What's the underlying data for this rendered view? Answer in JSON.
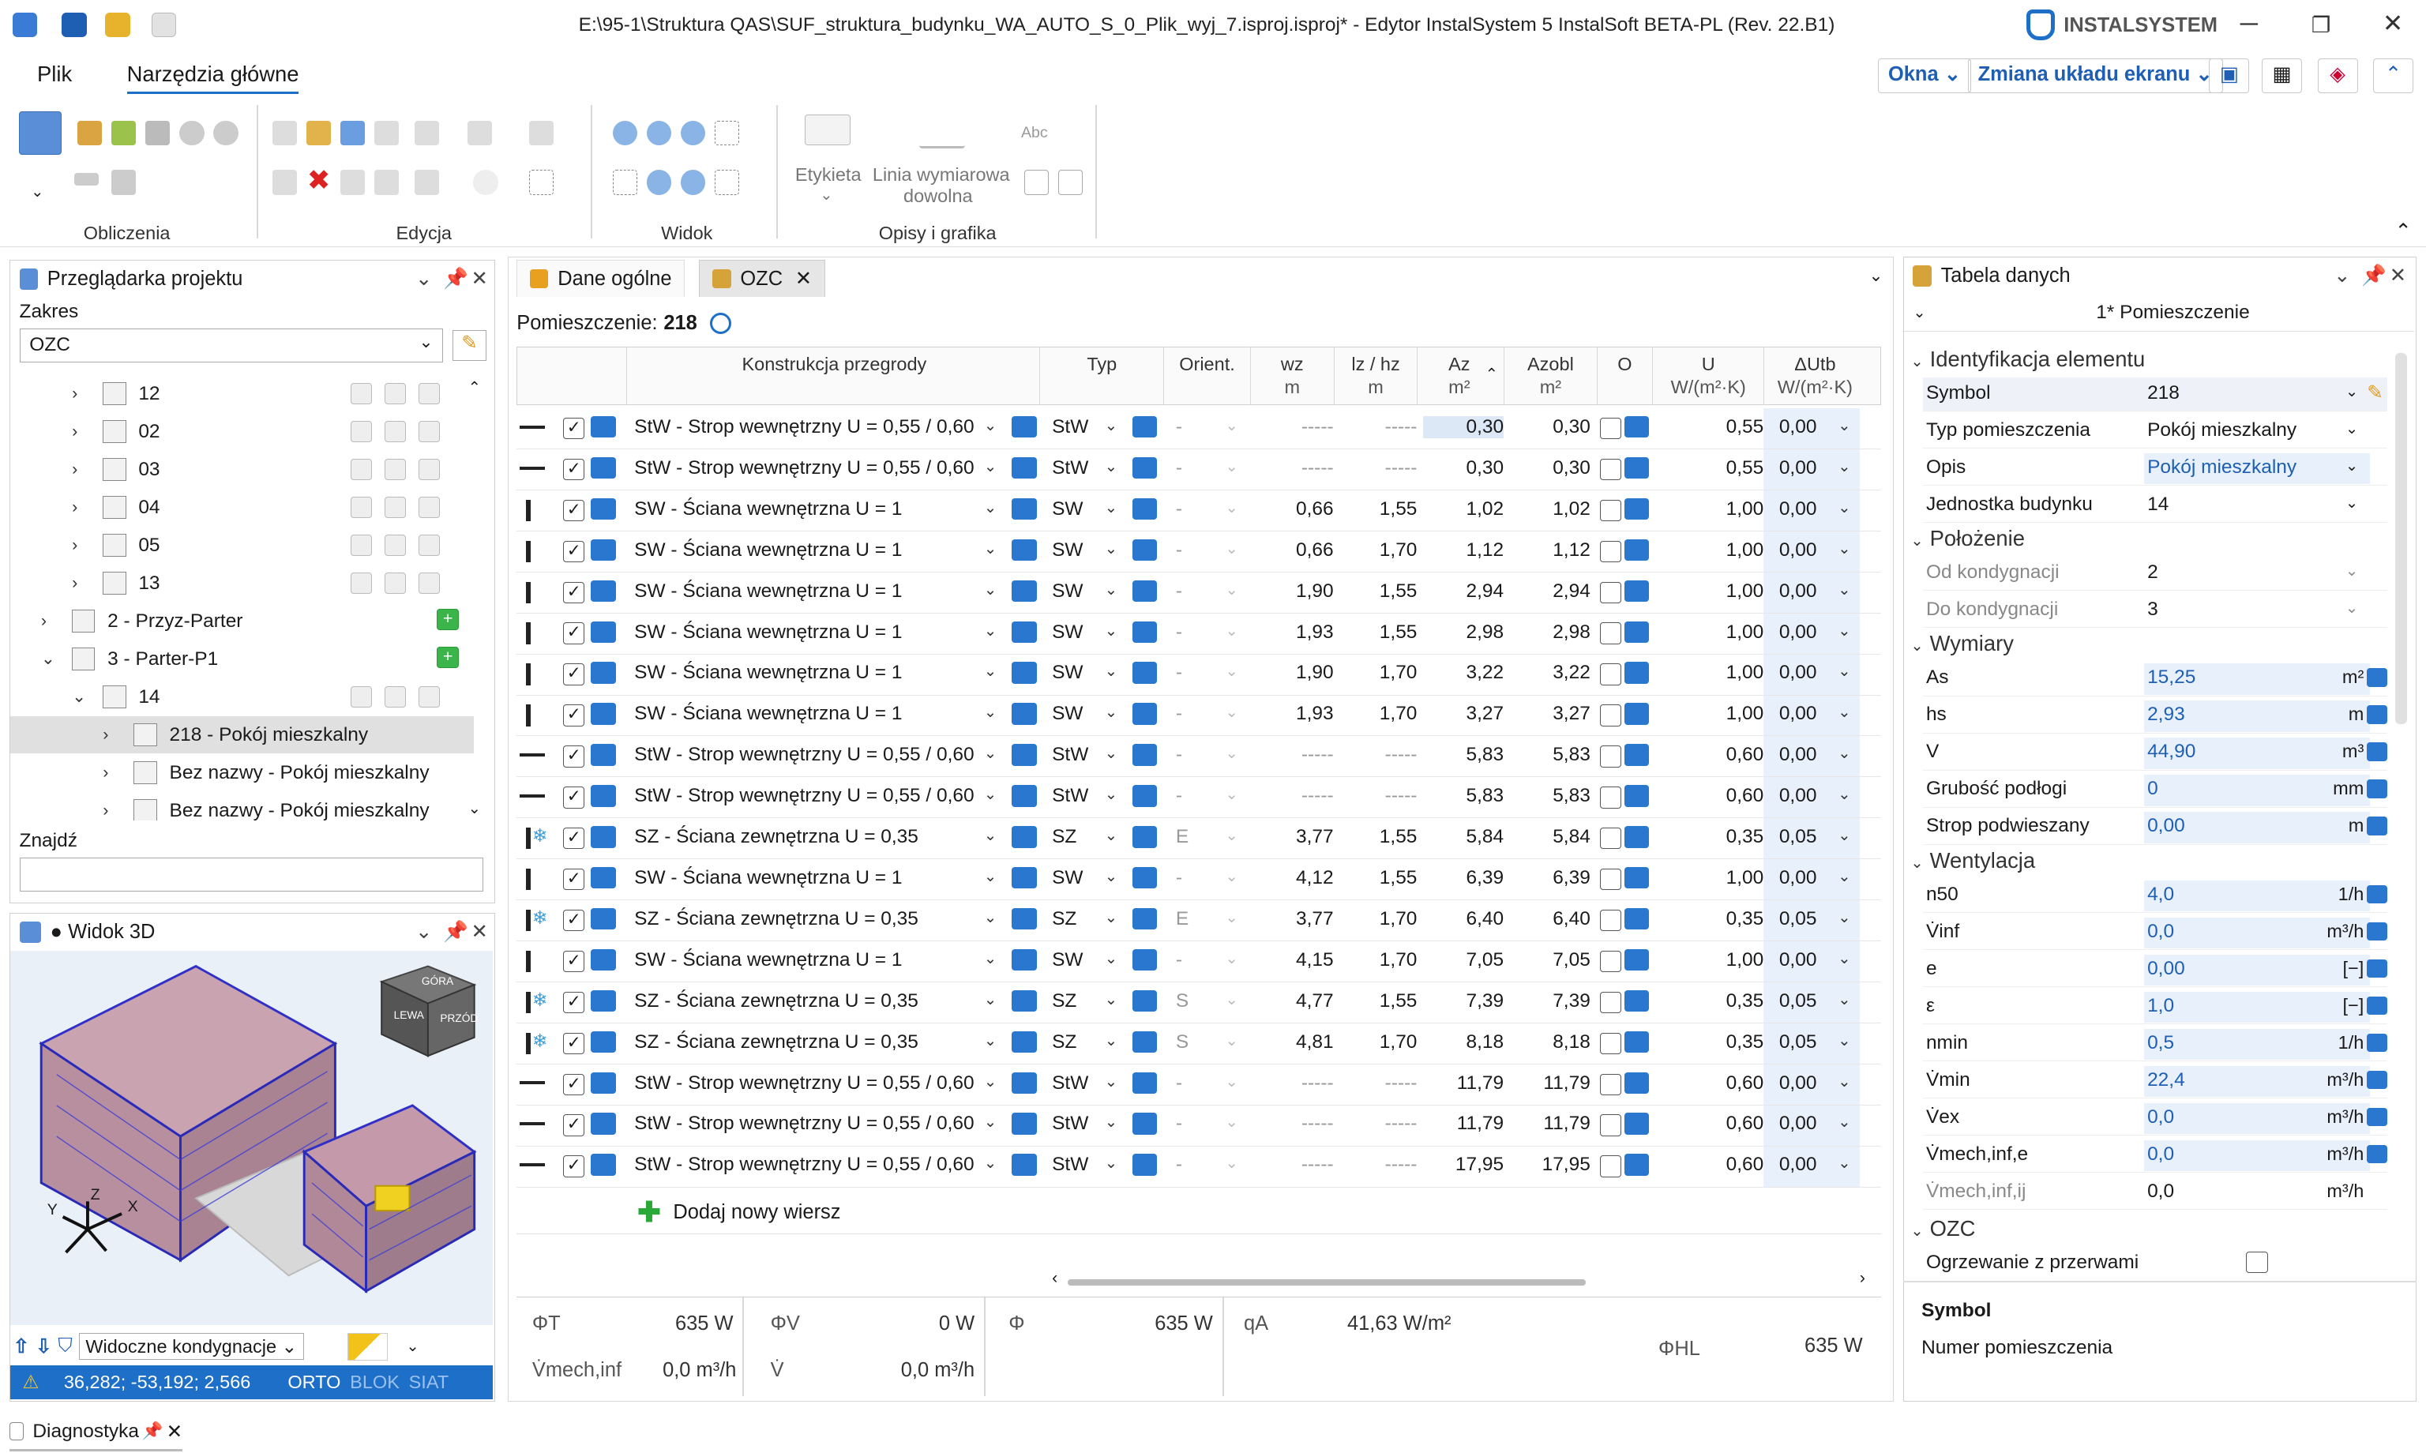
{
  "title": "E:\\95-1\\Struktura QAS\\SUF_struktura_budynku_WA_AUTO_S_0_Plik_wyj_7.isproj.isproj* - Edytor InstalSystem 5 InstalSoft BETA-PL (Rev. 22.B1)",
  "brand": "INSTALSYSTEM",
  "menu": {
    "file": "Plik",
    "tools": "Narzędzia główne"
  },
  "ribbon_right": {
    "windows": "Okna",
    "layout": "Zmiana układu ekranu"
  },
  "ribbon": {
    "groups": [
      "Obliczenia",
      "Edycja",
      "Widok",
      "Opisy i grafika"
    ],
    "label_tool": "Etykieta",
    "dim_tool_1": "Linia wymiarowa",
    "dim_tool_2": "dowolna",
    "abc": "Abc"
  },
  "browser": {
    "title": "Przeglądarka projektu",
    "scope_label": "Zakres",
    "scope_value": "OZC",
    "find_label": "Znajdź",
    "find_value": "",
    "tree": [
      {
        "label": "12",
        "level": 2
      },
      {
        "label": "02",
        "level": 2
      },
      {
        "label": "03",
        "level": 2
      },
      {
        "label": "04",
        "level": 2
      },
      {
        "label": "05",
        "level": 2
      },
      {
        "label": "13",
        "level": 2
      },
      {
        "label": "2 - Przyz-Parter",
        "level": 1
      },
      {
        "label": "3 - Parter-P1",
        "level": 1
      },
      {
        "label": "14",
        "level": 2
      },
      {
        "label": "218 - Pokój mieszkalny",
        "level": 3
      },
      {
        "label": "Bez nazwy - Pokój mieszkalny",
        "level": 3
      },
      {
        "label": "Bez nazwy - Pokój mieszkalny",
        "level": 3
      }
    ]
  },
  "view3d": {
    "title": "● Widok 3D",
    "cube_top": "GÓRA",
    "cube_left": "LEWA",
    "cube_front": "PRZÓD",
    "axis_x": "X",
    "axis_y": "Y",
    "axis_z": "Z",
    "storeys": "Widoczne kondygnacje",
    "coords": "36,282; -53,192; 2,566",
    "orto": "ORTO",
    "blok": "BLOK",
    "siat": "SIAT"
  },
  "tabs": {
    "general": "Dane ogólne",
    "ozc": "OZC"
  },
  "room": {
    "label": "Pomieszczenie:",
    "value": "218"
  },
  "columns": {
    "konstr": "Konstrukcja przegrody",
    "typ": "Typ",
    "orient": "Orient.",
    "wz": "wz",
    "wz_u": "m",
    "lz": "lz / hz",
    "lz_u": "m",
    "az": "Az",
    "az_u": "m²",
    "azobl": "Azobl",
    "azobl_u": "m²",
    "o": "O",
    "u": "U",
    "u_u": "W/(m²·K)",
    "dutb": "ΔUtb",
    "dutb_u": "W/(m²·K)"
  },
  "rows": [
    {
      "k": "StW - Strop wewnętrzny U = 0,55 / 0,60",
      "t": "StW",
      "o": "-",
      "w": "-----",
      "l": "-----",
      "a": "0,30",
      "ao": "0,30",
      "u": "0,55",
      "d": "0,00",
      "h": true
    },
    {
      "k": "StW - Strop wewnętrzny U = 0,55 / 0,60",
      "t": "StW",
      "o": "-",
      "w": "-----",
      "l": "-----",
      "a": "0,30",
      "ao": "0,30",
      "u": "0,55",
      "d": "0,00",
      "h": true
    },
    {
      "k": "SW - Ściana wewnętrzna U = 1",
      "t": "SW",
      "o": "-",
      "w": "0,66",
      "l": "1,55",
      "a": "1,02",
      "ao": "1,02",
      "u": "1,00",
      "d": "0,00",
      "h": false
    },
    {
      "k": "SW - Ściana wewnętrzna U = 1",
      "t": "SW",
      "o": "-",
      "w": "0,66",
      "l": "1,70",
      "a": "1,12",
      "ao": "1,12",
      "u": "1,00",
      "d": "0,00",
      "h": false
    },
    {
      "k": "SW - Ściana wewnętrzna U = 1",
      "t": "SW",
      "o": "-",
      "w": "1,90",
      "l": "1,55",
      "a": "2,94",
      "ao": "2,94",
      "u": "1,00",
      "d": "0,00",
      "h": false
    },
    {
      "k": "SW - Ściana wewnętrzna U = 1",
      "t": "SW",
      "o": "-",
      "w": "1,93",
      "l": "1,55",
      "a": "2,98",
      "ao": "2,98",
      "u": "1,00",
      "d": "0,00",
      "h": false
    },
    {
      "k": "SW - Ściana wewnętrzna U = 1",
      "t": "SW",
      "o": "-",
      "w": "1,90",
      "l": "1,70",
      "a": "3,22",
      "ao": "3,22",
      "u": "1,00",
      "d": "0,00",
      "h": false
    },
    {
      "k": "SW - Ściana wewnętrzna U = 1",
      "t": "SW",
      "o": "-",
      "w": "1,93",
      "l": "1,70",
      "a": "3,27",
      "ao": "3,27",
      "u": "1,00",
      "d": "0,00",
      "h": false
    },
    {
      "k": "StW - Strop wewnętrzny U = 0,55 / 0,60",
      "t": "StW",
      "o": "-",
      "w": "-----",
      "l": "-----",
      "a": "5,83",
      "ao": "5,83",
      "u": "0,60",
      "d": "0,00",
      "h": true
    },
    {
      "k": "StW - Strop wewnętrzny U = 0,55 / 0,60",
      "t": "StW",
      "o": "-",
      "w": "-----",
      "l": "-----",
      "a": "5,83",
      "ao": "5,83",
      "u": "0,60",
      "d": "0,00",
      "h": true
    },
    {
      "k": "SZ - Ściana zewnętrzna U = 0,35",
      "t": "SZ",
      "o": "E",
      "w": "3,77",
      "l": "1,55",
      "a": "5,84",
      "ao": "5,84",
      "u": "0,35",
      "d": "0,05",
      "h": false,
      "ext": true
    },
    {
      "k": "SW - Ściana wewnętrzna U = 1",
      "t": "SW",
      "o": "-",
      "w": "4,12",
      "l": "1,55",
      "a": "6,39",
      "ao": "6,39",
      "u": "1,00",
      "d": "0,00",
      "h": false
    },
    {
      "k": "SZ - Ściana zewnętrzna U = 0,35",
      "t": "SZ",
      "o": "E",
      "w": "3,77",
      "l": "1,70",
      "a": "6,40",
      "ao": "6,40",
      "u": "0,35",
      "d": "0,05",
      "h": false,
      "ext": true
    },
    {
      "k": "SW - Ściana wewnętrzna U = 1",
      "t": "SW",
      "o": "-",
      "w": "4,15",
      "l": "1,70",
      "a": "7,05",
      "ao": "7,05",
      "u": "1,00",
      "d": "0,00",
      "h": false
    },
    {
      "k": "SZ - Ściana zewnętrzna U = 0,35",
      "t": "SZ",
      "o": "S",
      "w": "4,77",
      "l": "1,55",
      "a": "7,39",
      "ao": "7,39",
      "u": "0,35",
      "d": "0,05",
      "h": false,
      "ext": true
    },
    {
      "k": "SZ - Ściana zewnętrzna U = 0,35",
      "t": "SZ",
      "o": "S",
      "w": "4,81",
      "l": "1,70",
      "a": "8,18",
      "ao": "8,18",
      "u": "0,35",
      "d": "0,05",
      "h": false,
      "ext": true
    },
    {
      "k": "StW - Strop wewnętrzny U = 0,55 / 0,60",
      "t": "StW",
      "o": "-",
      "w": "-----",
      "l": "-----",
      "a": "11,79",
      "ao": "11,79",
      "u": "0,60",
      "d": "0,00",
      "h": true
    },
    {
      "k": "StW - Strop wewnętrzny U = 0,55 / 0,60",
      "t": "StW",
      "o": "-",
      "w": "-----",
      "l": "-----",
      "a": "11,79",
      "ao": "11,79",
      "u": "0,60",
      "d": "0,00",
      "h": true
    },
    {
      "k": "StW - Strop wewnętrzny U = 0,55 / 0,60",
      "t": "StW",
      "o": "-",
      "w": "-----",
      "l": "-----",
      "a": "17,95",
      "ao": "17,95",
      "u": "0,60",
      "d": "0,00",
      "h": true
    }
  ],
  "add_row": "Dodaj nowy wiersz",
  "summary": {
    "phi_t_l": "ΦT",
    "phi_t": "635 W",
    "phi_v_l": "ΦV",
    "phi_v": "0 W",
    "phi_l": "Φ",
    "phi": "635 W",
    "qa_l": "qA",
    "qa": "41,63 W/m²",
    "vmech_l": "V̇mech,inf",
    "vmech": "0,0 m³/h",
    "v_l": "V̇",
    "v": "0,0 m³/h",
    "phl_l": "ΦHL",
    "phl": "635 W"
  },
  "datatable": {
    "title": "Tabela danych",
    "header": "1* Pomieszczenie",
    "sec_id": "Identyfikacja elementu",
    "symbol_l": "Symbol",
    "symbol": "218",
    "typ_l": "Typ pomieszczenia",
    "typ": "Pokój mieszkalny",
    "opis_l": "Opis",
    "opis": "Pokój mieszkalny",
    "jedn_l": "Jednostka budynku",
    "jedn": "14",
    "sec_pol": "Położenie",
    "od_l": "Od kondygnacji",
    "od": "2",
    "do_l": "Do kondygnacji",
    "do": "3",
    "sec_wym": "Wymiary",
    "as_l": "As",
    "as": "15,25",
    "as_u": "m²",
    "hs_l": "hs",
    "hs": "2,93",
    "hs_u": "m",
    "v_l": "V",
    "v": "44,90",
    "v_u": "m³",
    "gr_l": "Grubość podłogi",
    "gr": "0",
    "gr_u": "mm",
    "sp_l": "Strop podwieszany",
    "sp": "0,00",
    "sp_u": "m",
    "sec_went": "Wentylacja",
    "n50_l": "n50",
    "n50": "4,0",
    "n50_u": "1/h",
    "vinf_l": "V̇inf",
    "vinf": "0,0",
    "vinf_u": "m³/h",
    "e_l": "e",
    "e": "0,00",
    "e_u": "[−]",
    "eps_l": "ε",
    "eps": "1,0",
    "eps_u": "[−]",
    "nmin_l": "nmin",
    "nmin": "0,5",
    "nmin_u": "1/h",
    "vmin_l": "V̇min",
    "vmin": "22,4",
    "vmin_u": "m³/h",
    "vex_l": "V̇ex",
    "vex": "0,0",
    "vex_u": "m³/h",
    "vme_l": "V̇mech,inf,e",
    "vme": "0,0",
    "vme_u": "m³/h",
    "vmi_l": "V̇mech,inf,ij",
    "vmi": "0,0",
    "vmi_u": "m³/h",
    "sec_ozc": "OZC",
    "ogrz_l": "Ogrzewanie z przerwami",
    "desc_title": "Symbol",
    "desc_text": "Numer pomieszczenia"
  },
  "diag": "Diagnostyka"
}
